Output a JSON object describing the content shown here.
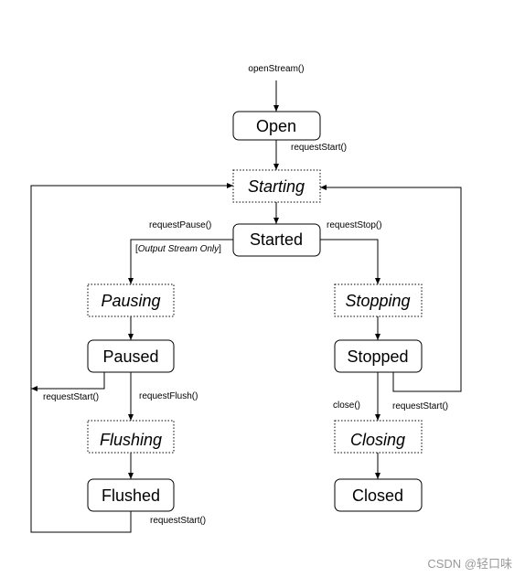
{
  "states": {
    "open": "Open",
    "starting": "Starting",
    "started": "Started",
    "pausing": "Pausing",
    "paused": "Paused",
    "flushing": "Flushing",
    "flushed": "Flushed",
    "stopping": "Stopping",
    "stopped": "Stopped",
    "closing": "Closing",
    "closed": "Closed"
  },
  "transitions": {
    "open_stream": "openStream()",
    "open_request_start": "requestStart()",
    "request_pause": "requestPause()",
    "output_only_prefix": "[",
    "output_only": "Output Stream Only",
    "output_only_suffix": "]",
    "request_stop": "requestStop()",
    "paused_request_start": "requestStart()",
    "request_flush": "requestFlush()",
    "flushed_request_start": "requestStart()",
    "close": "close()",
    "stopped_request_start": "requestStart()"
  },
  "watermark": "CSDN @轻口味"
}
